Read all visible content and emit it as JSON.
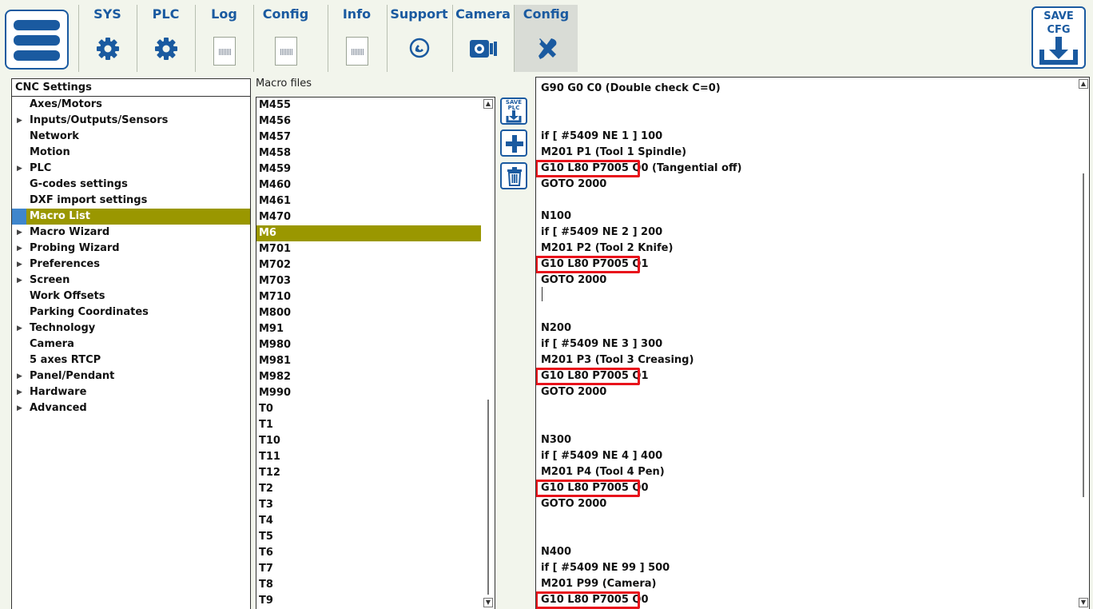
{
  "toolbar": {
    "tabs": [
      {
        "label": "SYS",
        "icon": "gear-icon"
      },
      {
        "label": "PLC",
        "icon": "gear-icon"
      },
      {
        "label": "Log",
        "icon": "log-icon"
      },
      {
        "label": "Config",
        "icon": "log-icon"
      },
      {
        "label": "Info",
        "icon": "log-icon"
      },
      {
        "label": "Support",
        "icon": "phone-icon"
      },
      {
        "label": "Camera",
        "icon": "camera-icon"
      },
      {
        "label": "Config",
        "icon": "tools-icon",
        "active": true
      }
    ],
    "save_cfg_top": "SAVE",
    "save_cfg_bottom": "CFG",
    "accent_color": "#1a5aa0"
  },
  "settings": {
    "title": "CNC Settings",
    "items": [
      {
        "label": "Axes/Motors",
        "expandable": false
      },
      {
        "label": "Inputs/Outputs/Sensors",
        "expandable": true
      },
      {
        "label": "Network",
        "expandable": false
      },
      {
        "label": "Motion",
        "expandable": false
      },
      {
        "label": "PLC",
        "expandable": true
      },
      {
        "label": "G-codes settings",
        "expandable": false
      },
      {
        "label": "DXF import settings",
        "expandable": false
      },
      {
        "label": "Macro List",
        "expandable": false,
        "selected": true
      },
      {
        "label": "Macro Wizard",
        "expandable": true
      },
      {
        "label": "Probing Wizard",
        "expandable": true
      },
      {
        "label": "Preferences",
        "expandable": true
      },
      {
        "label": "Screen",
        "expandable": true
      },
      {
        "label": "Work Offsets",
        "expandable": false
      },
      {
        "label": "Parking Coordinates",
        "expandable": false
      },
      {
        "label": "Technology",
        "expandable": true
      },
      {
        "label": "Camera",
        "expandable": false
      },
      {
        "label": "5 axes RTCP",
        "expandable": false
      },
      {
        "label": "Panel/Pendant",
        "expandable": true
      },
      {
        "label": "Hardware",
        "expandable": true
      },
      {
        "label": "Advanced",
        "expandable": true
      }
    ],
    "selection_color": "#9a9700"
  },
  "macros": {
    "title": "Macro files",
    "items": [
      "M455",
      "M456",
      "M457",
      "M458",
      "M459",
      "M460",
      "M461",
      "M470",
      "M6",
      "M701",
      "M702",
      "M703",
      "M710",
      "M800",
      "M91",
      "M980",
      "M981",
      "M982",
      "M990",
      "T0",
      "T1",
      "T10",
      "T11",
      "T12",
      "T2",
      "T3",
      "T4",
      "T5",
      "T6",
      "T7",
      "T8",
      "T9"
    ],
    "selected": "M6"
  },
  "side_buttons": {
    "save_plc_top": "SAVE",
    "save_plc_bottom": "PLC"
  },
  "editor": {
    "lines": [
      {
        "row": 0,
        "text": "G90 G0 C0 (Double check C=0)"
      },
      {
        "row": 3,
        "text": "if [ #5409 NE 1 ] 100"
      },
      {
        "row": 4,
        "text": "M201 P1 (Tool 1 Spindle)"
      },
      {
        "row": 5,
        "text": "G10 L80 P7005 Q0 (Tangential off)",
        "highlight": "G10 L80 P7005 Q0"
      },
      {
        "row": 6,
        "text": "GOTO 2000"
      },
      {
        "row": 8,
        "text": "N100"
      },
      {
        "row": 9,
        "text": "if [ #5409 NE 2 ] 200"
      },
      {
        "row": 10,
        "text": "M201 P2 (Tool 2 Knife)"
      },
      {
        "row": 11,
        "text": "G10 L80 P7005 Q1",
        "highlight": "G10 L80 P7005 Q1"
      },
      {
        "row": 12,
        "text": "GOTO 2000"
      },
      {
        "row": 15,
        "text": "N200"
      },
      {
        "row": 16,
        "text": "if [ #5409 NE 3 ] 300"
      },
      {
        "row": 17,
        "text": "M201 P3 (Tool 3 Creasing)"
      },
      {
        "row": 18,
        "text": "G10 L80 P7005 Q1",
        "highlight": "G10 L80 P7005 Q1"
      },
      {
        "row": 19,
        "text": "GOTO 2000"
      },
      {
        "row": 22,
        "text": "N300"
      },
      {
        "row": 23,
        "text": "if [ #5409 NE 4 ] 400"
      },
      {
        "row": 24,
        "text": "M201 P4 (Tool 4 Pen)"
      },
      {
        "row": 25,
        "text": "G10 L80 P7005 Q0",
        "highlight": "G10 L80 P7005 Q0"
      },
      {
        "row": 26,
        "text": "GOTO 2000"
      },
      {
        "row": 29,
        "text": "N400"
      },
      {
        "row": 30,
        "text": "if [ #5409 NE 99 ] 500"
      },
      {
        "row": 31,
        "text": "M201 P99 (Camera)"
      },
      {
        "row": 32,
        "text": "G10 L80 P7005 Q0",
        "highlight": "G10 L80 P7005 Q0"
      }
    ],
    "highlight_color": "#e8121b"
  }
}
